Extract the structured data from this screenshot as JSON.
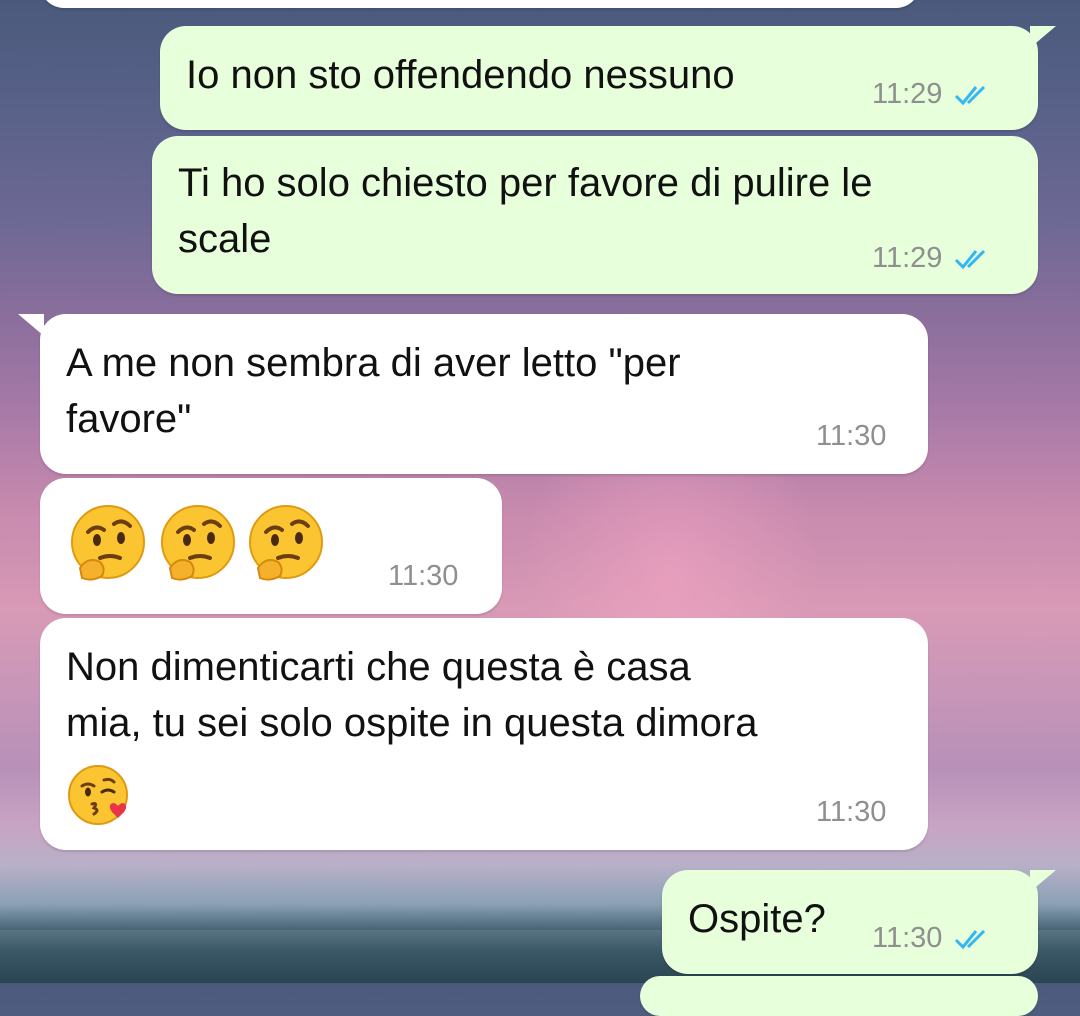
{
  "messages": [
    {
      "direction": "outgoing",
      "text": "Io non sto offendendo nessuno",
      "time": "11:29",
      "status": "read"
    },
    {
      "direction": "outgoing",
      "text": "Ti ho solo chiesto per favore di pulire le",
      "text2": "scale",
      "time": "11:29",
      "status": "read"
    },
    {
      "direction": "incoming",
      "text": "A me non sembra di aver letto \"per",
      "text2": "favore\"",
      "time": "11:30"
    },
    {
      "direction": "incoming",
      "emojis": [
        "thinking-face",
        "thinking-face",
        "thinking-face"
      ],
      "time": "11:30"
    },
    {
      "direction": "incoming",
      "text": "Non dimenticarti che questa è casa",
      "text2": "mia, tu sei solo ospite in questa dimora",
      "emoji": "face-blowing-a-kiss",
      "time": "11:30"
    },
    {
      "direction": "outgoing",
      "text": "Ospite?",
      "time": "11:30",
      "status": "read"
    }
  ],
  "colors": {
    "outgoing_bubble": "#e7ffdb",
    "incoming_bubble": "#ffffff",
    "read_ticks": "#34b7f1",
    "timestamp": "#8f8f8f"
  }
}
